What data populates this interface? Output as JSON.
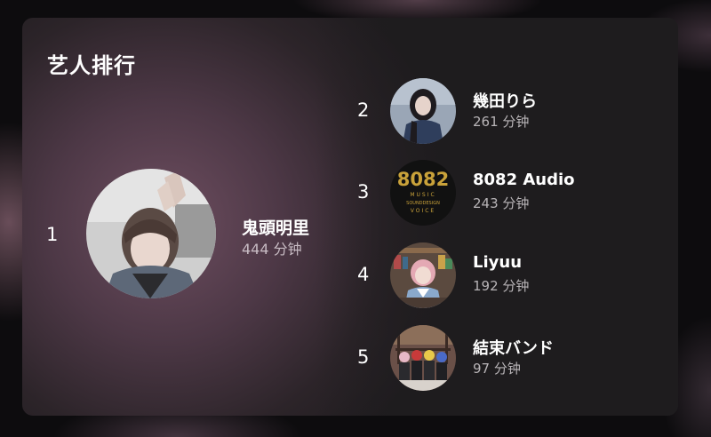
{
  "panel": {
    "title": "艺人排行"
  },
  "artists": [
    {
      "rank": "1",
      "name": "鬼頭明里",
      "minutes": "444 分钟"
    },
    {
      "rank": "2",
      "name": "幾田りら",
      "minutes": "261 分钟"
    },
    {
      "rank": "3",
      "name": "8082 Audio",
      "minutes": "243 分钟"
    },
    {
      "rank": "4",
      "name": "Liyuu",
      "minutes": "192 分钟"
    },
    {
      "rank": "5",
      "name": "結束バンド",
      "minutes": "97 分钟"
    }
  ],
  "logo_text": {
    "top": "8082",
    "line1": "MUSIC",
    "line2": "SOUNDDESIGN",
    "line3": "VOICE"
  },
  "colors": {
    "accent_gold": "#c9a23a",
    "card_background": "#1e1c1e",
    "secondary_text": "#b8b4b7"
  }
}
